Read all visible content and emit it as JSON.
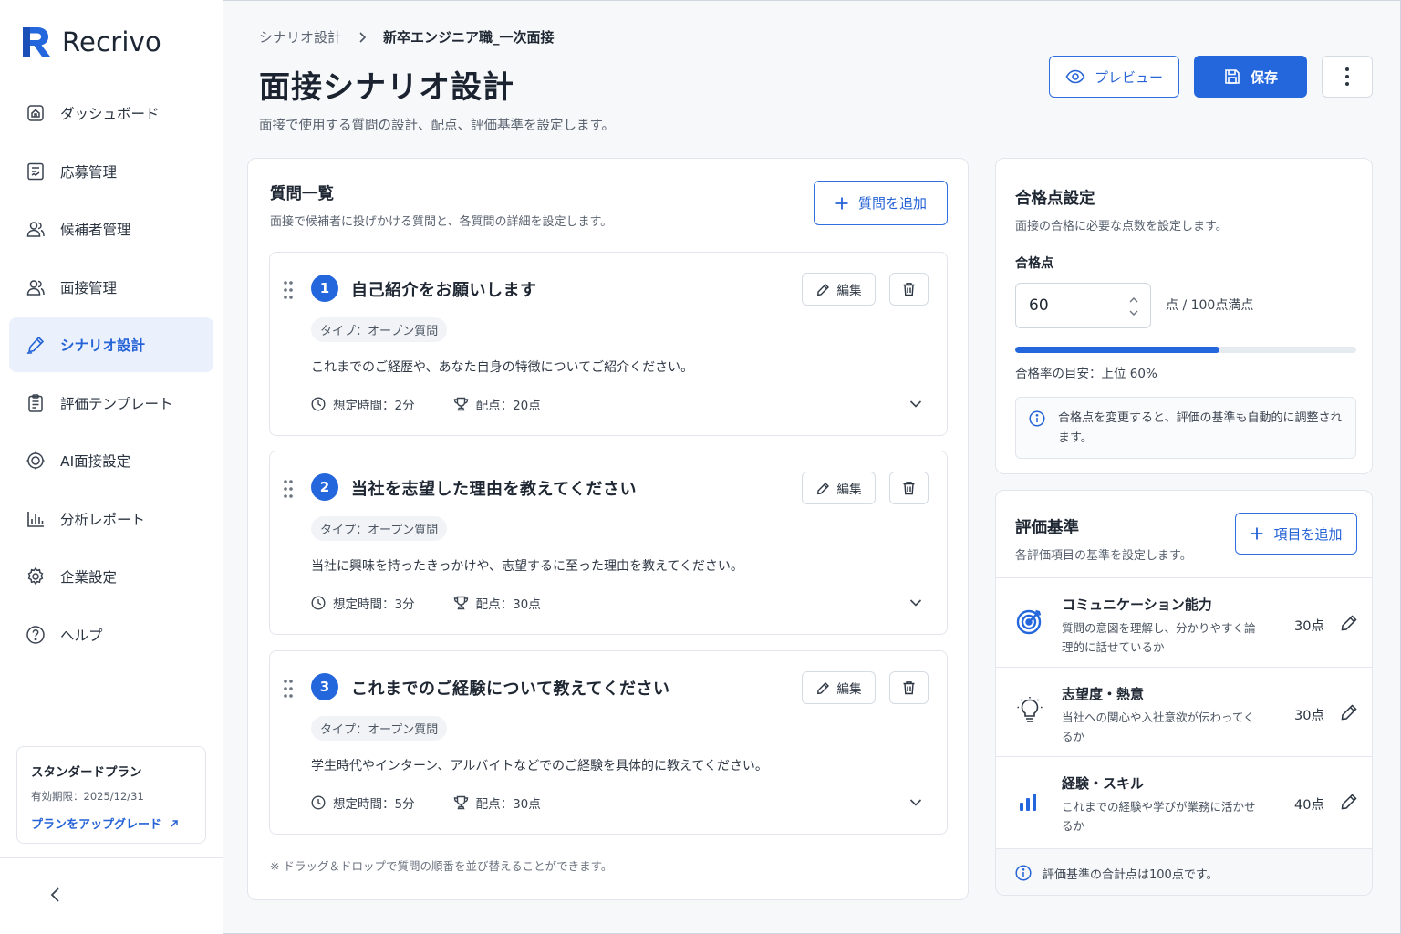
{
  "app": {
    "name": "Recrivo"
  },
  "sidebar": {
    "items": [
      {
        "label": "ダッシュボード",
        "icon": "home-icon"
      },
      {
        "label": "応募管理",
        "icon": "document-icon"
      },
      {
        "label": "候補者管理",
        "icon": "users-icon"
      },
      {
        "label": "面接管理",
        "icon": "users-icon"
      },
      {
        "label": "シナリオ設計",
        "icon": "pen-icon",
        "active": true
      },
      {
        "label": "評価テンプレート",
        "icon": "clipboard-icon"
      },
      {
        "label": "AI面接設定",
        "icon": "ai-icon"
      },
      {
        "label": "分析レポート",
        "icon": "bar-chart-icon"
      },
      {
        "label": "企業設定",
        "icon": "gear-icon"
      },
      {
        "label": "ヘルプ",
        "icon": "help-icon"
      }
    ],
    "plan": {
      "name": "スタンダードプラン",
      "expiry": "有効期限：2025/12/31",
      "upgrade": "プランをアップグレード"
    }
  },
  "header": {
    "breadcrumb": [
      "シナリオ設計",
      "新卒エンジニア職_一次面接"
    ],
    "title": "面接シナリオ設計",
    "subtitle": "面接で使用する質問の設計、配点、評価基準を設定します。",
    "preview_label": "プレビュー",
    "save_label": "保存"
  },
  "questions": {
    "title": "質問一覧",
    "subtitle": "面接で候補者に投げかける質問と、各質問の詳細を設定します。",
    "add_label": "質問を追加",
    "edit_label": "編集",
    "items": [
      {
        "num": "1",
        "title": "自己紹介をお願いします",
        "type": "タイプ：オープン質問",
        "desc": "これまでのご経歴や、あなた自身の特徴についてご紹介ください。",
        "time": "想定時間：2分",
        "score": "配点：20点"
      },
      {
        "num": "2",
        "title": "当社を志望した理由を教えてください",
        "type": "タイプ：オープン質問",
        "desc": "当社に興味を持ったきっかけや、志望するに至った理由を教えてください。",
        "time": "想定時間：3分",
        "score": "配点：30点"
      },
      {
        "num": "3",
        "title": "これまでのご経験について教えてください",
        "type": "タイプ：オープン質問",
        "desc": "学生時代やインターン、アルバイトなどでのご経験を具体的に教えてください。",
        "time": "想定時間：5分",
        "score": "配点：30点"
      }
    ],
    "note": "※ ドラッグ＆ドロップで質問の順番を並び替えることができます。"
  },
  "pass": {
    "title": "合格点設定",
    "subtitle": "面接の合格に必要な点数を設定します。",
    "label": "合格点",
    "value": "60",
    "unit": "点 / 100点満点",
    "progress": 0.6,
    "rate": "合格率の目安：上位 60%",
    "info": "合格点を変更すると、評価の基準も自動的に調整されます。"
  },
  "criteria": {
    "title": "評価基準",
    "subtitle": "各評価項目の基準を設定します。",
    "add_label": "項目を追加",
    "items": [
      {
        "name": "コミュニケーション能力",
        "desc": "質問の意図を理解し、分かりやすく論理的に話せているか",
        "score": "30点",
        "icon": "target-icon"
      },
      {
        "name": "志望度・熱意",
        "desc": "当社への関心や入社意欲が伝わってくるか",
        "score": "30点",
        "icon": "lightbulb-icon"
      },
      {
        "name": "経験・スキル",
        "desc": "これまでの経験や学びが業務に活かせるか",
        "score": "40点",
        "icon": "bar-chart-icon"
      }
    ],
    "footer": "評価基準の合計点は100点です。"
  },
  "colors": {
    "accent": "#2467dd",
    "active_bg": "#eaf1fd"
  }
}
